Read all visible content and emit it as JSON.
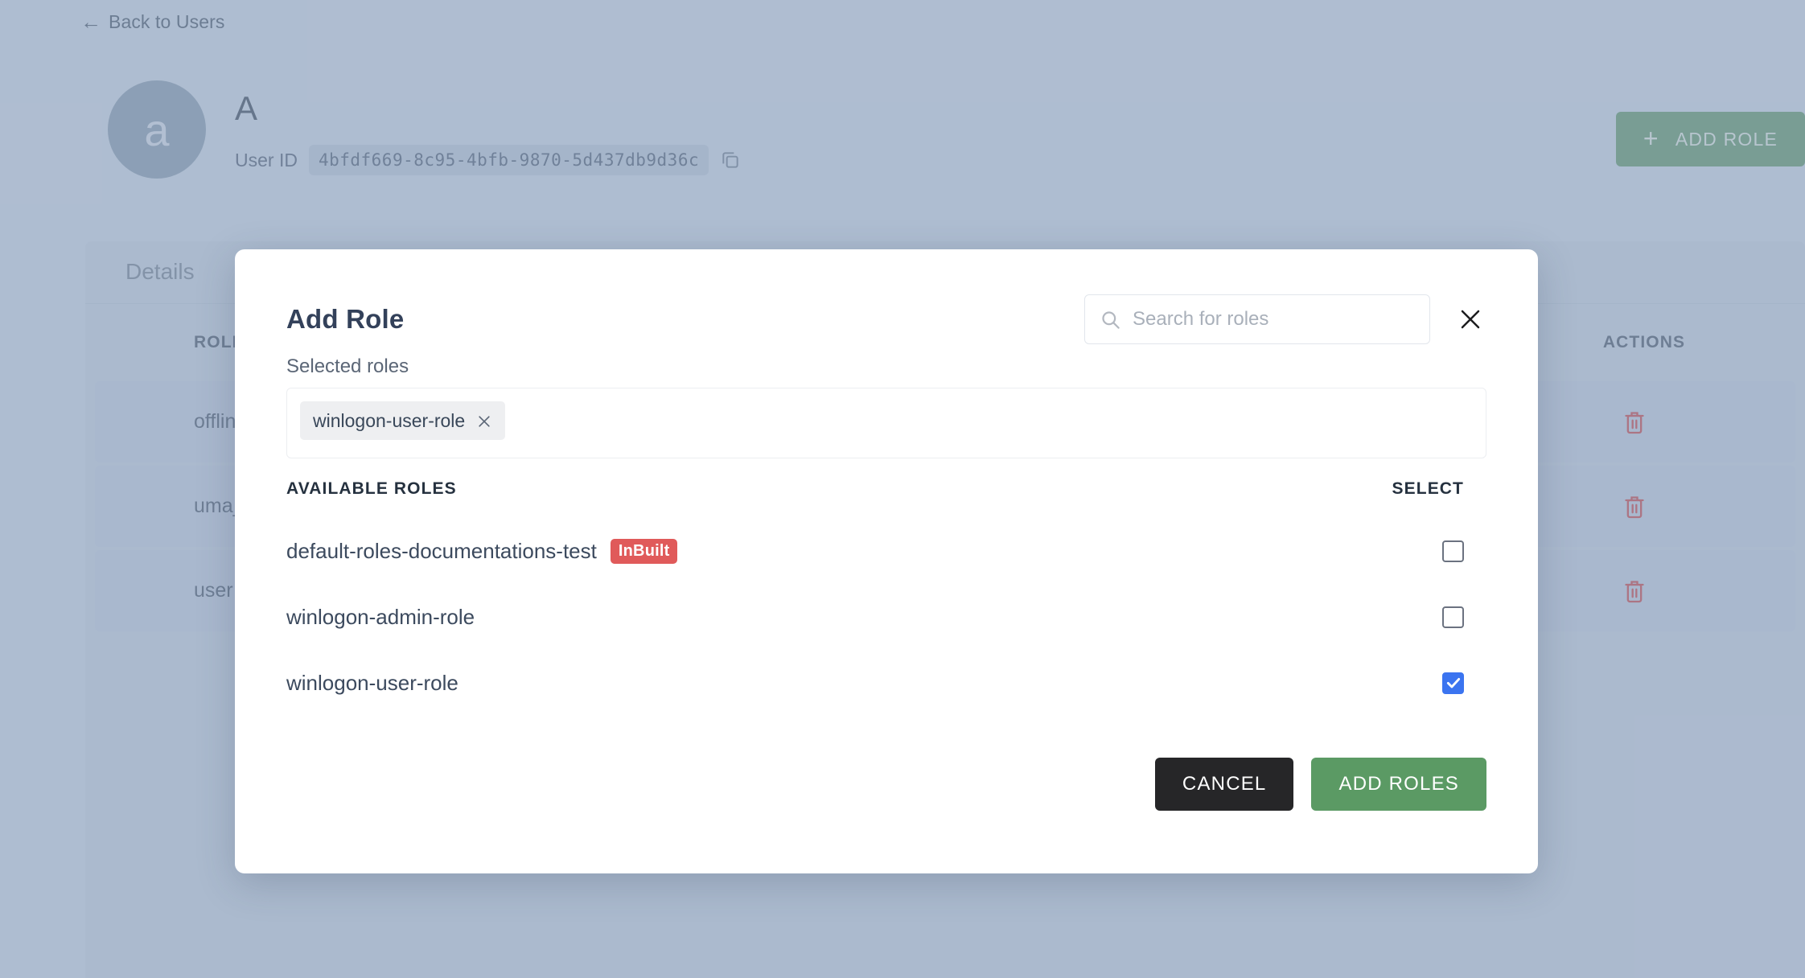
{
  "background": {
    "back_link": "Back to Users",
    "back_icon": "arrow-left-icon",
    "user": {
      "avatar_initial": "a",
      "name": "A",
      "user_id_label": "User ID",
      "user_id_value": "4bfdf669-8c95-4bfb-9870-5d437db9d36c",
      "copy_icon": "copy-icon"
    },
    "add_role_button": {
      "label": "ADD ROLE",
      "icon": "plus-icon",
      "color": "#579161"
    },
    "tabs": [
      {
        "label": "Details"
      }
    ],
    "table": {
      "columns": [
        "ROLE NAME",
        "ACTIONS"
      ],
      "rows": [
        {
          "role_name": "offline_access",
          "action_icon": "trash-icon"
        },
        {
          "role_name": "uma_authorization",
          "action_icon": "trash-icon"
        },
        {
          "role_name": "user",
          "action_icon": "trash-icon"
        }
      ]
    }
  },
  "modal": {
    "title": "Add Role",
    "search": {
      "placeholder": "Search for roles",
      "value": "",
      "icon": "search-icon"
    },
    "close_icon": "close-icon",
    "selected_roles": {
      "label": "Selected roles",
      "chips": [
        {
          "label": "winlogon-user-role",
          "remove_icon": "close-icon"
        }
      ]
    },
    "available_roles": {
      "header_label": "AVAILABLE ROLES",
      "select_label": "SELECT",
      "items": [
        {
          "name": "default-roles-documentations-test",
          "badge": "InBuilt",
          "checked": false
        },
        {
          "name": "winlogon-admin-role",
          "badge": "",
          "checked": false
        },
        {
          "name": "winlogon-user-role",
          "badge": "",
          "checked": true
        }
      ]
    },
    "actions": {
      "cancel_label": "CANCEL",
      "confirm_label": "ADD ROLES"
    },
    "colors": {
      "badge": "#e05a5a",
      "checkbox_checked": "#3b74f0",
      "confirm": "#5b9a64",
      "cancel": "#262628"
    }
  }
}
